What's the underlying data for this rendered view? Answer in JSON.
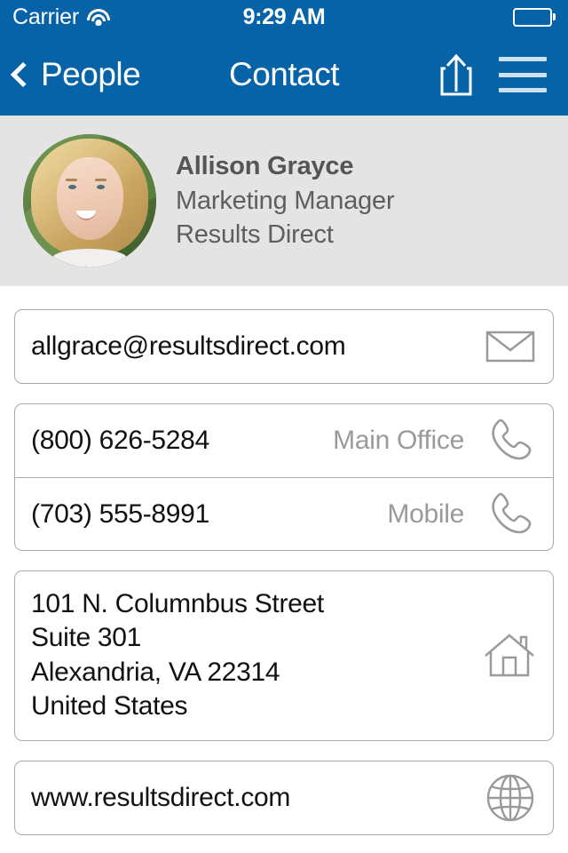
{
  "status_bar": {
    "carrier": "Carrier",
    "wifi_icon": "wifi-icon",
    "time": "9:29 AM",
    "battery_icon": "battery-full-icon"
  },
  "nav_bar": {
    "back_label": "People",
    "back_icon": "chevron-left-icon",
    "title": "Contact",
    "share_icon": "share-icon",
    "menu_icon": "hamburger-menu-icon",
    "background_color": "#0663a8"
  },
  "contact_header": {
    "avatar_icon": "contact-photo",
    "name": "Allison Grayce",
    "job_title": "Marketing Manager",
    "organization": "Results Direct",
    "background_color": "#e4e4e4"
  },
  "email_card": {
    "address": "allgrace@resultsdirect.com",
    "icon": "envelope-icon"
  },
  "phone_card": {
    "rows": [
      {
        "number": "(800) 626-5284",
        "label": "Main Office",
        "icon": "phone-icon"
      },
      {
        "number": "(703) 555-8991",
        "label": "Mobile",
        "icon": "phone-icon"
      }
    ]
  },
  "address_card": {
    "line1": "101 N. Columnbus Street",
    "line2": "Suite 301",
    "line3": "Alexandria, VA 22314",
    "line4": "United States",
    "icon": "house-icon"
  },
  "website_card": {
    "url": "www.resultsdirect.com",
    "icon": "globe-icon"
  },
  "colors": {
    "accent": "#0663a8",
    "header_bg": "#e4e4e4",
    "card_border": "#a8a8a8",
    "label_gray": "#9a9a9a",
    "icon_gray": "#9a9a9a"
  }
}
